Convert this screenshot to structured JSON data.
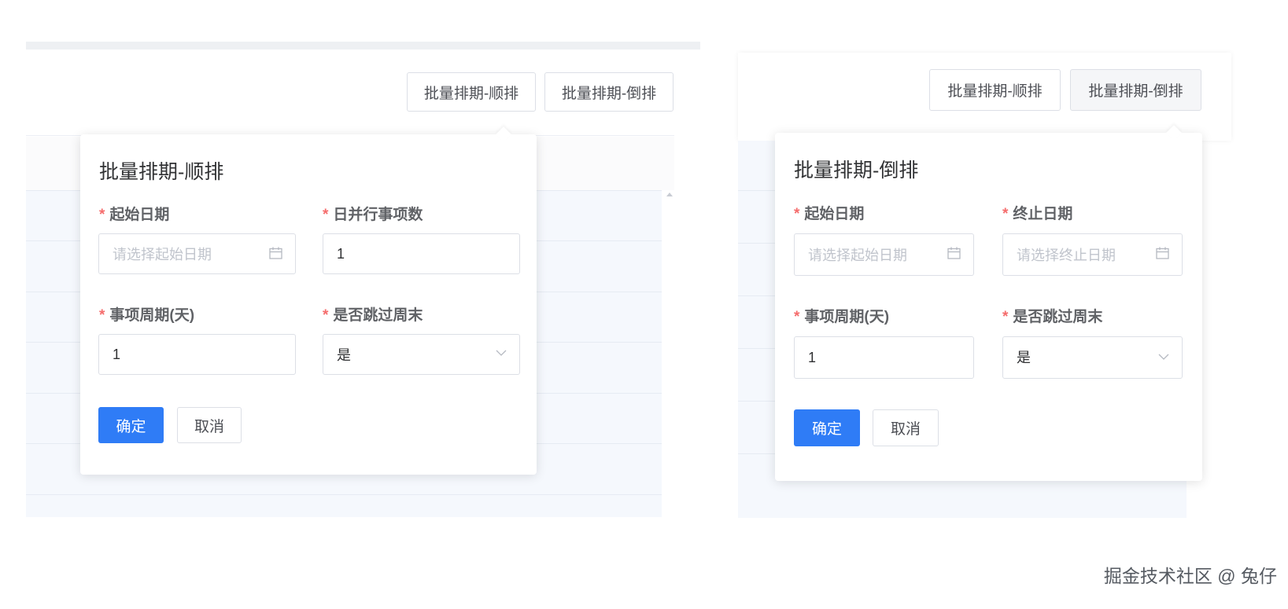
{
  "left": {
    "toolbar": {
      "btn_forward": "批量排期-顺排",
      "btn_reverse": "批量排期-倒排"
    },
    "popover": {
      "title": "批量排期-顺排",
      "fields": {
        "start_date_label": "起始日期",
        "start_date_placeholder": "请选择起始日期",
        "parallel_label": "日并行事项数",
        "parallel_value": "1",
        "cycle_label": "事项周期(天)",
        "cycle_value": "1",
        "skip_weekend_label": "是否跳过周末",
        "skip_weekend_value": "是"
      },
      "confirm": "确定",
      "cancel": "取消"
    }
  },
  "right": {
    "toolbar": {
      "btn_forward": "批量排期-顺排",
      "btn_reverse": "批量排期-倒排"
    },
    "popover": {
      "title": "批量排期-倒排",
      "fields": {
        "start_date_label": "起始日期",
        "start_date_placeholder": "请选择起始日期",
        "end_date_label": "终止日期",
        "end_date_placeholder": "请选择终止日期",
        "cycle_label": "事项周期(天)",
        "cycle_value": "1",
        "skip_weekend_label": "是否跳过周末",
        "skip_weekend_value": "是"
      },
      "confirm": "确定",
      "cancel": "取消"
    }
  },
  "required_mark": "*",
  "watermark": "掘金技术社区 @ 兔仔",
  "colors": {
    "primary": "#2f7cf6",
    "required": "#f56c6c",
    "border": "#dcdfe6",
    "placeholder": "#c0c4cc"
  },
  "icons": {
    "date": "calendar-icon",
    "select": "chevron-down-icon"
  }
}
